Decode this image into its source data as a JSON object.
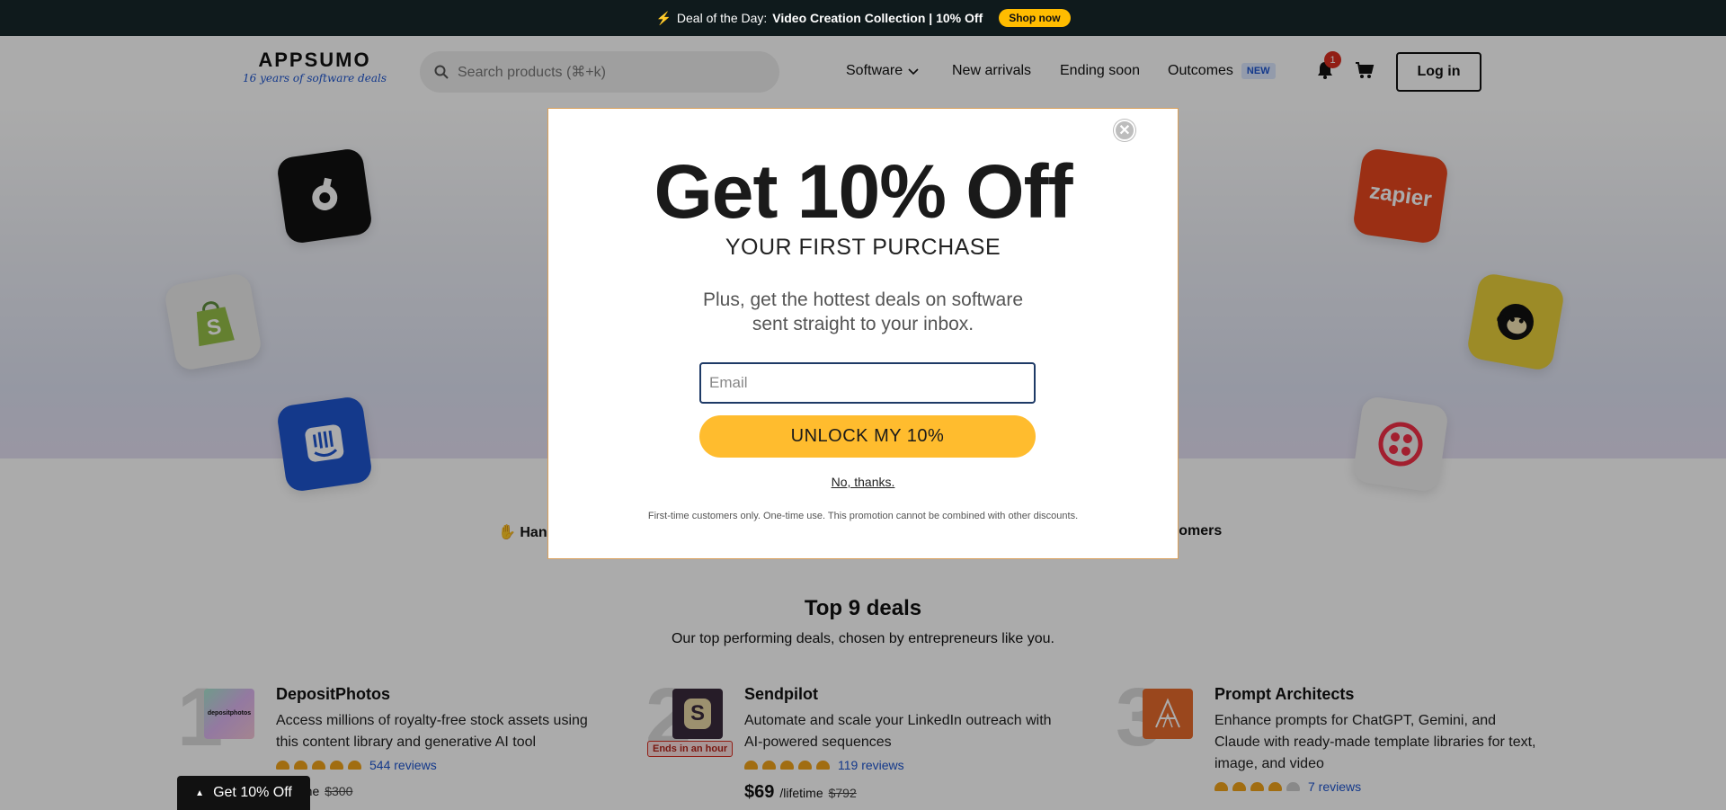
{
  "promo": {
    "icon": "lightning-icon",
    "prefix": "Deal of the Day:",
    "highlight": "Video Creation Collection | 10% Off",
    "button": "Shop now"
  },
  "header": {
    "logo_word": "APPSUMO",
    "logo_tagline": "16 years of software deals",
    "search_placeholder": "Search products (⌘+k)",
    "nav": {
      "software": "Software",
      "new_arrivals": "New arrivals",
      "ending_soon": "Ending soon",
      "outcomes": "Outcomes",
      "outcomes_badge": "NEW"
    },
    "notification_count": "1",
    "login": "Log in"
  },
  "hero_apps": [
    {
      "name": "zapier",
      "label": "zapier",
      "color": "#e8461e"
    },
    {
      "name": "shopify",
      "label": "S",
      "color": "#96bf48"
    },
    {
      "name": "mailchimp",
      "label": "mailchimp",
      "color": "#ffe01b"
    },
    {
      "name": "intercom",
      "label": "intercom",
      "color": "#1f56d0"
    },
    {
      "name": "twilio",
      "label": "twilio",
      "color": "#f22f46"
    }
  ],
  "trust": {
    "left": "Han",
    "right": "stomers"
  },
  "deals": {
    "title": "Top 9 deals",
    "subtitle": "Our top performing deals, chosen by entrepreneurs like you.",
    "items": [
      {
        "rank": "1",
        "name": "DepositPhotos",
        "description": "Access millions of royalty-free stock assets using this content library and generative AI tool",
        "reviews": "544 reviews",
        "price": "",
        "per": "/lifetime",
        "old_price": "$300"
      },
      {
        "rank": "2",
        "name": "Sendpilot",
        "description": "Automate and scale your LinkedIn outreach with AI-powered sequences",
        "reviews": "119 reviews",
        "price": "$69",
        "per": "/lifetime",
        "old_price": "$792",
        "badge": "Ends in an hour"
      },
      {
        "rank": "3",
        "name": "Prompt Architects",
        "description": "Enhance prompts for ChatGPT, Gemini, and Claude with ready-made template libraries for text, image, and video",
        "reviews": "7 reviews"
      }
    ]
  },
  "floating_button": "Get 10% Off",
  "modal": {
    "title": "Get 10% Off",
    "subtitle": "YOUR FIRST PURCHASE",
    "body": "Plus, get the hottest deals on software sent straight to your inbox.",
    "email_placeholder": "Email",
    "cta": "UNLOCK MY 10%",
    "decline": "No, thanks.",
    "fine_print": "First-time customers only. One-time use. This promotion cannot be combined with other discounts."
  },
  "colors": {
    "accent_yellow": "#ffbc2e",
    "promo_bg": "#0f1a1c",
    "link_blue": "#1f56d0"
  }
}
